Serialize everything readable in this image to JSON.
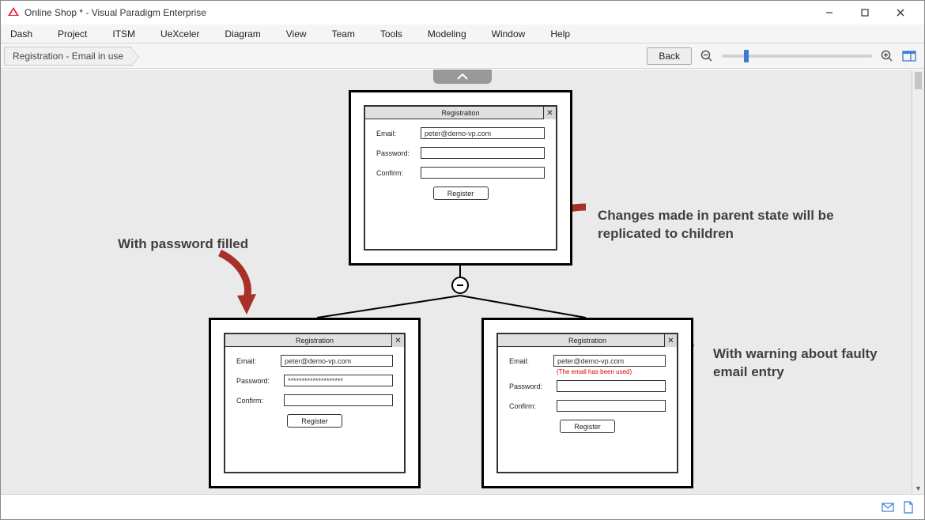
{
  "window": {
    "title": "Online Shop * - Visual Paradigm Enterprise"
  },
  "menu": {
    "items": [
      "Dash",
      "Project",
      "ITSM",
      "UeXceler",
      "Diagram",
      "View",
      "Team",
      "Tools",
      "Modeling",
      "Window",
      "Help"
    ]
  },
  "toolbar": {
    "breadcrumb": "Registration - Email in use",
    "back": "Back"
  },
  "annotations": {
    "left": "With password filled",
    "right_top": "Changes made in parent state will be replicated to children",
    "right_bottom": "With warning about faulty email entry"
  },
  "mock": {
    "title": "Registration",
    "emailLabel": "Email:",
    "passwordLabel": "Password:",
    "confirmLabel": "Confirm:",
    "register": "Register",
    "emailValue": "peter@demo-vp.com",
    "passwordMasked": "********************",
    "warning": "(The email has been used)"
  }
}
